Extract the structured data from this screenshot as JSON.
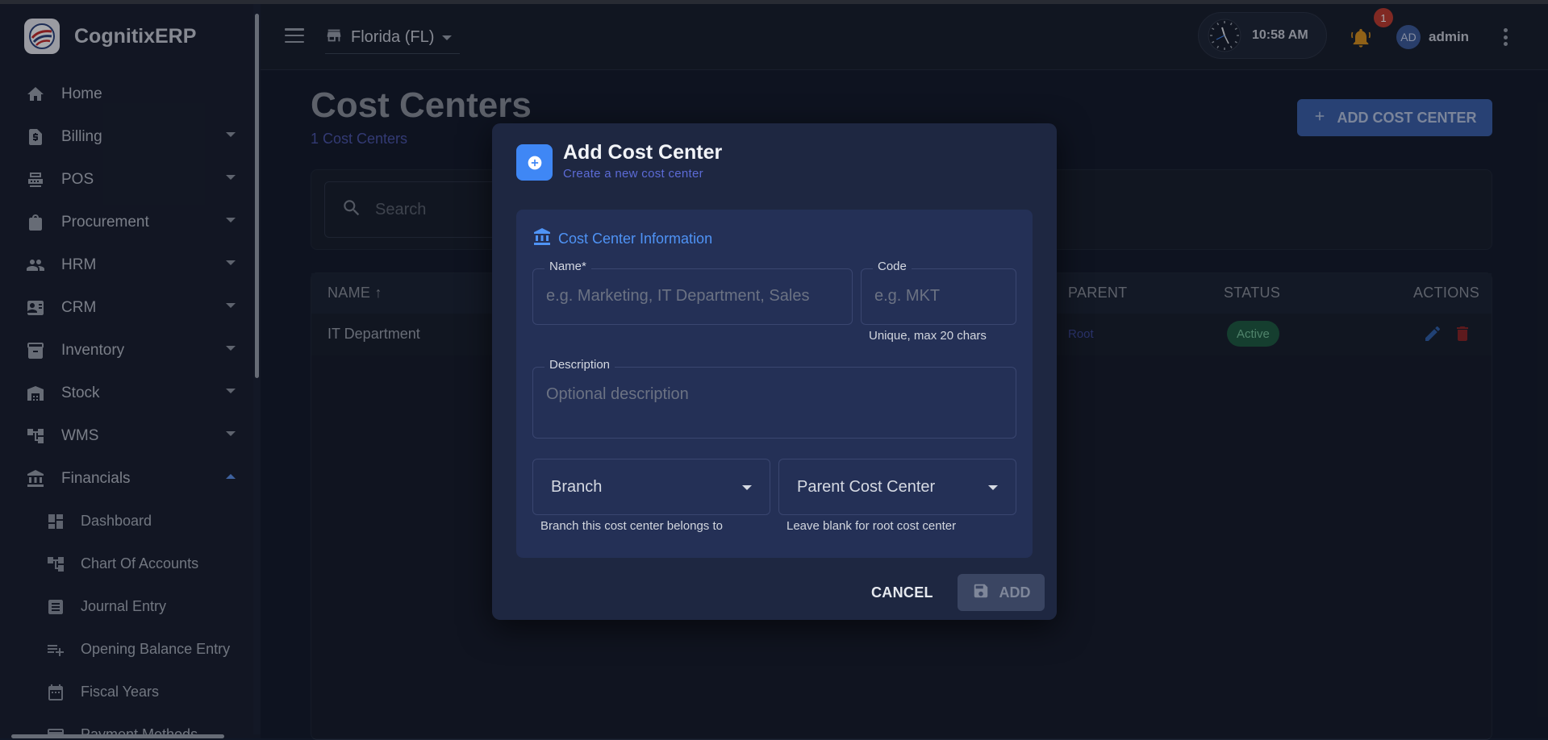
{
  "app": {
    "name": "CognitixERP"
  },
  "sidebar": {
    "items": [
      {
        "label": "Home",
        "icon": "home-icon",
        "expandable": false
      },
      {
        "label": "Billing",
        "icon": "billing-icon",
        "expandable": true
      },
      {
        "label": "POS",
        "icon": "pos-icon",
        "expandable": true
      },
      {
        "label": "Procurement",
        "icon": "shopping-bag-icon",
        "expandable": true
      },
      {
        "label": "HRM",
        "icon": "people-icon",
        "expandable": true
      },
      {
        "label": "CRM",
        "icon": "contact-card-icon",
        "expandable": true
      },
      {
        "label": "Inventory",
        "icon": "archive-icon",
        "expandable": true
      },
      {
        "label": "Stock",
        "icon": "warehouse-icon",
        "expandable": true
      },
      {
        "label": "WMS",
        "icon": "tree-icon",
        "expandable": true
      },
      {
        "label": "Financials",
        "icon": "bank-icon",
        "expandable": true,
        "expanded": true
      }
    ],
    "sub_items": [
      {
        "label": "Dashboard",
        "icon": "dashboard-icon"
      },
      {
        "label": "Chart Of Accounts",
        "icon": "tree-icon"
      },
      {
        "label": "Journal Entry",
        "icon": "journal-icon"
      },
      {
        "label": "Opening Balance Entry",
        "icon": "playlist-add-icon"
      },
      {
        "label": "Fiscal Years",
        "icon": "calendar-icon"
      },
      {
        "label": "Payment Methods",
        "icon": "payment-icon"
      }
    ]
  },
  "topbar": {
    "store": "Florida (FL)",
    "time": "10:58 AM",
    "notification_count": "1",
    "avatar_initials": "AD",
    "user_name": "admin"
  },
  "page": {
    "title": "Cost Centers",
    "subtitle": "1 Cost Centers",
    "add_button": "ADD COST CENTER",
    "search_placeholder": "Search"
  },
  "table": {
    "headers": {
      "name": "NAME ↑",
      "parent": "PARENT",
      "status": "STATUS",
      "actions": "ACTIONS"
    },
    "rows": [
      {
        "name": "IT Department",
        "parent": "Root",
        "status": "Active"
      }
    ]
  },
  "dialog": {
    "title": "Add Cost Center",
    "subtitle": "Create a new cost center",
    "section_title": "Cost Center Information",
    "name_label": "Name*",
    "name_placeholder": "e.g. Marketing, IT Department, Sales",
    "code_label": "Code",
    "code_placeholder": "e.g. MKT",
    "code_helper": "Unique, max 20 chars",
    "description_label": "Description",
    "description_placeholder": "Optional description",
    "branch_label": "Branch",
    "branch_helper": "Branch this cost center belongs to",
    "parent_label": "Parent Cost Center",
    "parent_helper": "Leave blank for root cost center",
    "cancel": "CANCEL",
    "add": "ADD"
  },
  "colors": {
    "accent": "#3f87f5",
    "status_active": "#1c5a3e",
    "delete": "#d32f2f"
  }
}
